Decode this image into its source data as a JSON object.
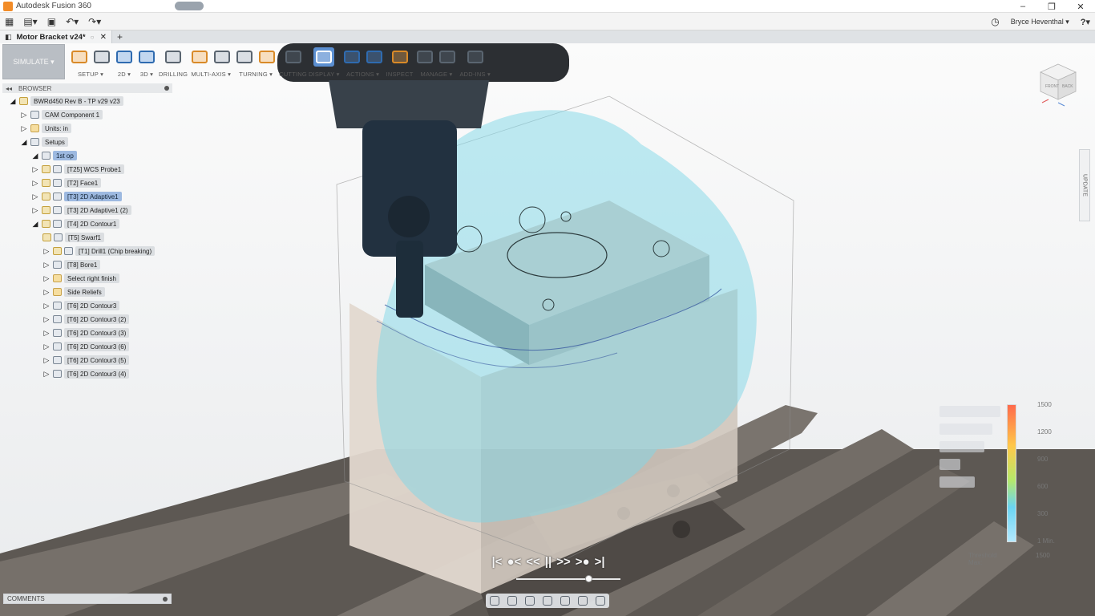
{
  "window": {
    "title": "Autodesk Fusion 360",
    "controls": [
      "–",
      "❐",
      "✕"
    ]
  },
  "menubar": {
    "apps_icon": "grid-icon",
    "file_icon": "file-icon",
    "save_icon": "save-icon",
    "undo_icon": "undo-icon",
    "redo_icon": "redo-icon",
    "user": "Bryce Heventhal ▾",
    "help": "?▾"
  },
  "tab": {
    "title": "Motor Bracket v24*",
    "close": "✕",
    "new_tab": "+"
  },
  "toolbar": {
    "workspace": "SIMULATE ▾",
    "groups": [
      {
        "label": "SETUP ▾",
        "icons": [
          "setup-icon",
          "folder-icon"
        ]
      },
      {
        "label": "2D ▾",
        "icons": [
          "2d-adaptive-icon"
        ]
      },
      {
        "label": "3D ▾",
        "icons": [
          "3d-adaptive-icon"
        ]
      },
      {
        "label": "DRILLING",
        "icons": [
          "drill-icon"
        ]
      },
      {
        "label": "MULTI-AXIS ▾",
        "icons": [
          "multiaxis-icon",
          "swarf-icon"
        ]
      },
      {
        "label": "TURNING ▾",
        "icons": [
          "turning-icon",
          "face-icon"
        ]
      },
      {
        "label": "CUTTING",
        "icons": [
          "cutting-icon"
        ]
      },
      {
        "label": "DISPLAY ▾",
        "icons": [
          "display-icon"
        ]
      },
      {
        "label": "ACTIONS ▾",
        "icons": [
          "post-icon",
          "setup-sheet-icon"
        ]
      },
      {
        "label": "INSPECT",
        "icons": [
          "inspect-icon"
        ]
      },
      {
        "label": "MANAGE ▾",
        "icons": [
          "tool-library-icon",
          "template-icon"
        ]
      },
      {
        "label": "ADD-INS ▾",
        "icons": [
          "addins-icon"
        ]
      }
    ]
  },
  "browser": {
    "title": "BROWSER",
    "root": "BWRd450 Rev B - TP v29 v23",
    "items": [
      {
        "level": 1,
        "label": "CAM Component 1",
        "icon": "component-icon",
        "open": false
      },
      {
        "level": 1,
        "label": "Units: in",
        "icon": "folder-icon",
        "open": false
      },
      {
        "level": 1,
        "label": "Setups",
        "icon": "setups-icon",
        "open": true
      },
      {
        "level": 2,
        "label": "1st op",
        "icon": "setup-icon",
        "open": true,
        "selected": true
      },
      {
        "level": 3,
        "label": "[T25] WCS Probe1",
        "icon": "probe-icon",
        "open": false
      },
      {
        "level": 3,
        "label": "[T2] Face1",
        "icon": "face-icon",
        "open": false
      },
      {
        "level": 3,
        "label": "[T3] 2D Adaptive1",
        "icon": "adaptive-icon",
        "open": false,
        "selected": true
      },
      {
        "level": 3,
        "label": "[T3] 2D Adaptive1 (2)",
        "icon": "adaptive-icon",
        "open": false
      },
      {
        "level": 3,
        "label": "[T4] 2D Contour1",
        "icon": "contour-icon",
        "open": true
      },
      {
        "level": 4,
        "label": "[T5] Swarf1",
        "icon": "swarf-icon",
        "open": false
      },
      {
        "level": 4,
        "label": "[T1] Drill1 (Chip breaking)",
        "icon": "drill-icon",
        "open": false
      },
      {
        "level": 4,
        "label": "[T8] Bore1",
        "icon": "bore-icon",
        "open": false
      },
      {
        "level": 4,
        "label": "Select right finish",
        "icon": "folder-icon",
        "open": false
      },
      {
        "level": 4,
        "label": "Side Reliefs",
        "icon": "folder-icon",
        "open": false
      },
      {
        "level": 4,
        "label": "[T6] 2D Contour3",
        "icon": "contour-icon",
        "open": false
      },
      {
        "level": 4,
        "label": "[T6] 2D Contour3 (2)",
        "icon": "contour-icon",
        "open": false
      },
      {
        "level": 4,
        "label": "[T6] 2D Contour3 (3)",
        "icon": "contour-icon",
        "open": false
      },
      {
        "level": 4,
        "label": "[T6] 2D Contour3 (6)",
        "icon": "contour-icon",
        "open": false
      },
      {
        "level": 4,
        "label": "[T6] 2D Contour3 (5)",
        "icon": "contour-icon",
        "open": false
      },
      {
        "level": 4,
        "label": "[T6] 2D Contour3 (4)",
        "icon": "contour-icon",
        "open": false
      }
    ]
  },
  "viewcube": {
    "front": "FRONT",
    "back": "BACK"
  },
  "side_tab": "UPDATE",
  "legend": {
    "ticks": [
      "1500",
      "1200",
      "900",
      "600",
      "300",
      "1 Min."
    ],
    "threshold": "Threshold",
    "max": "Max:",
    "max_value": "1500"
  },
  "player": {
    "first": "|<",
    "prev_op": "●<",
    "rewind": "<<",
    "pause": "||",
    "forward": ">>",
    "next_op": ">●",
    "last": ">|"
  },
  "comments": {
    "title": "COMMENTS"
  },
  "colors": {
    "accent": "#5b8fd1",
    "spindle": "#22313f",
    "fixture": "#6f6862",
    "stock": "#d8cfc6",
    "part": "#8fb6bd"
  }
}
